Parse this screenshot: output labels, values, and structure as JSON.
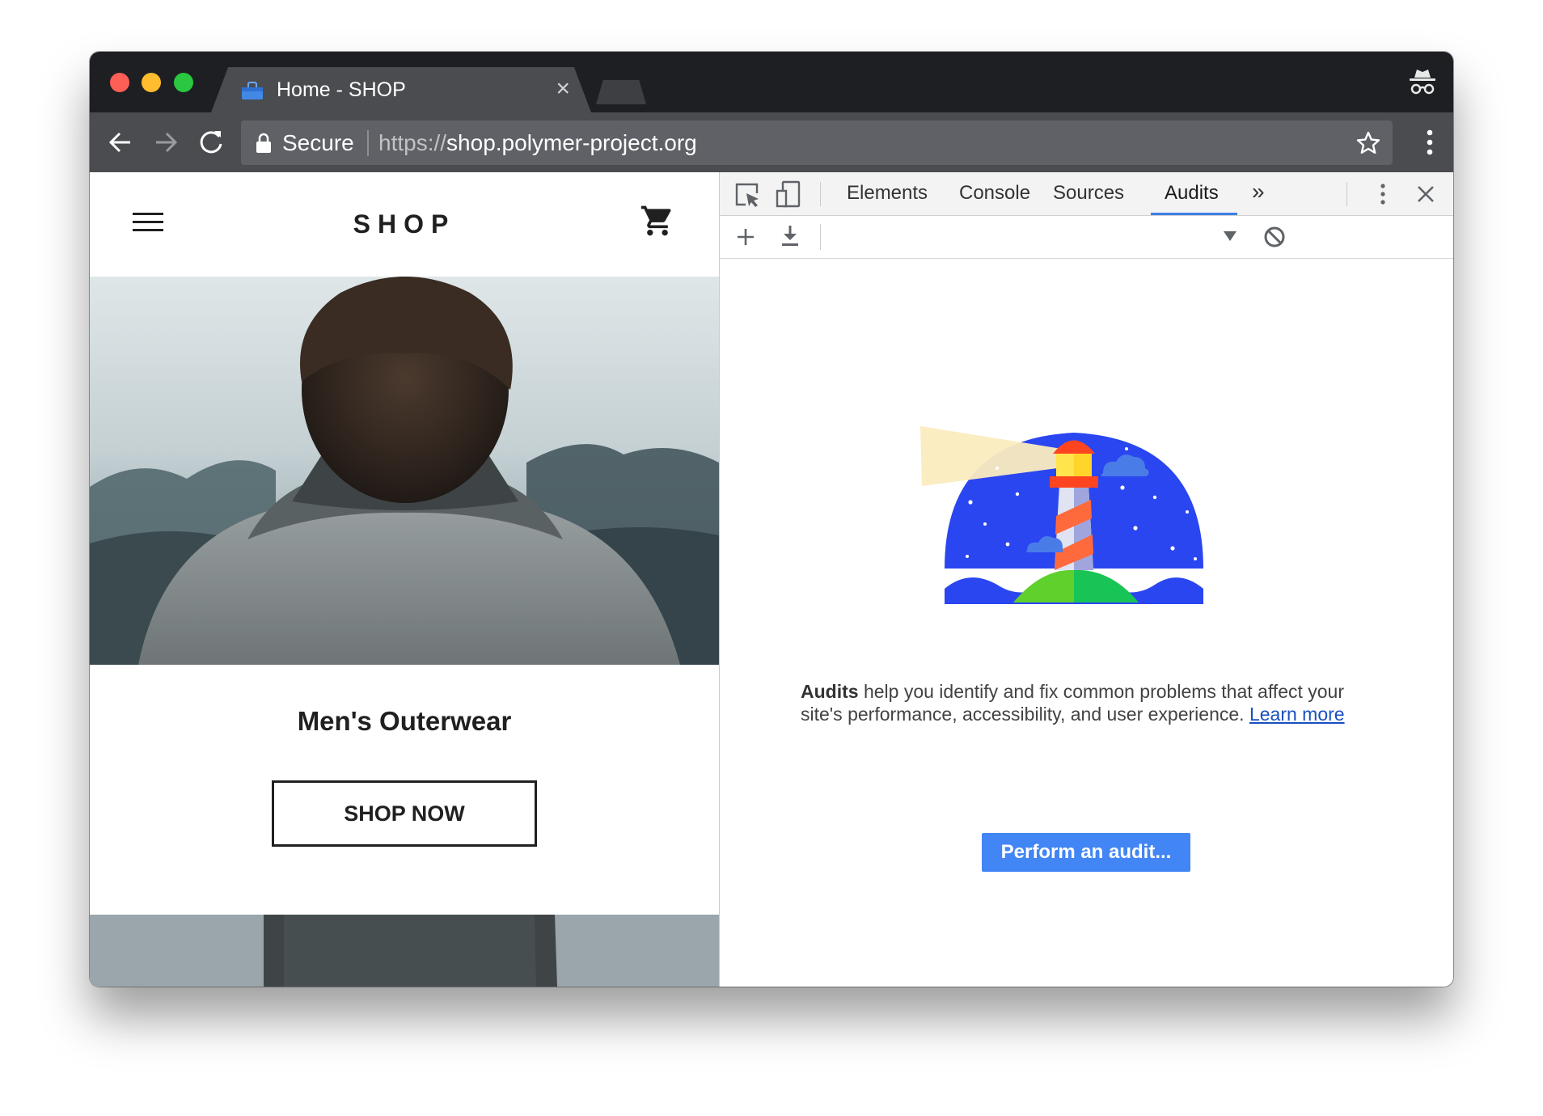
{
  "window": {
    "tab": {
      "title": "Home - SHOP",
      "close_glyph": "×"
    },
    "toolbar": {
      "secure_label": "Secure",
      "url_scheme": "https://",
      "url_host": "shop.polymer-project.org"
    }
  },
  "page": {
    "logo": "SHOP",
    "category_title": "Men's Outerwear",
    "shop_now_label": "SHOP NOW"
  },
  "devtools": {
    "tabs": [
      {
        "label": "Elements"
      },
      {
        "label": "Console"
      },
      {
        "label": "Sources"
      },
      {
        "label": "Audits"
      }
    ],
    "active_tab": "Audits",
    "overflow_glyph": "»",
    "audits": {
      "desc_bold": "Audits",
      "desc_text": " help you identify and fix common problems that affect your site's performance, accessibility, and user experience. ",
      "learn_more": "Learn more",
      "perform_button": "Perform an audit..."
    }
  },
  "colors": {
    "accent": "#4285f4",
    "tab_underline": "#3c7fe8",
    "link": "#1a4fbf",
    "lighthouse_sky": "#2a46f0"
  }
}
